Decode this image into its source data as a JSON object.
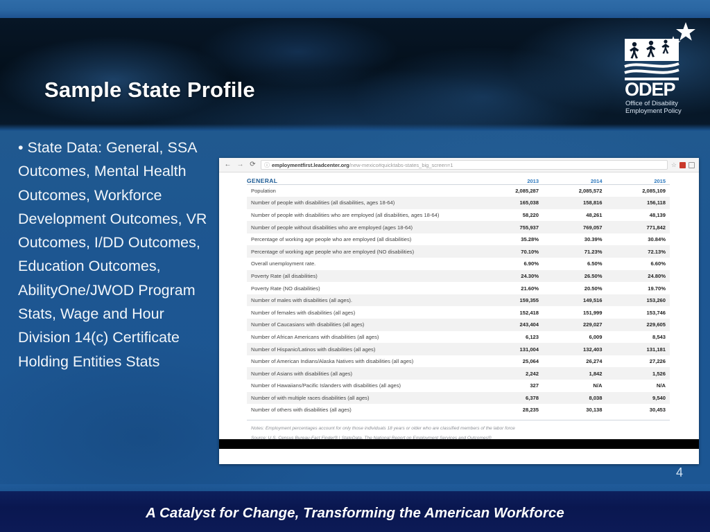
{
  "slide": {
    "title": "Sample State Profile",
    "number": "4",
    "footer": "A Catalyst for Change, Transforming the American Workforce",
    "colors": {
      "body_blue": "#1c5693",
      "hero_dark": "#05101e",
      "footer_navy": "#0a1750",
      "table_header_blue": "#1b5a94"
    }
  },
  "bullet": {
    "marker": "•",
    "text": "State Data: General, SSA Outcomes, Mental Health Outcomes, Workforce Development Outcomes, VR Outcomes, I/DD Outcomes, Education Outcomes, AbilityOne/JWOD Program Stats, Wage and Hour Division 14(c) Certificate Holding Entities Stats"
  },
  "logo": {
    "name": "odep-logo",
    "acronym": "ODEP",
    "line1": "Office of Disability",
    "line2": "Employment Policy"
  },
  "browser": {
    "back_icon": "←",
    "forward_icon": "→",
    "reload_icon": "⟳",
    "info_icon": "ⓘ",
    "star_icon": "☆",
    "url_bold": "employmentfirst.leadcenter.org",
    "url_rest": "/new-mexico#quicktabs-states_big_screen=1"
  },
  "chart_data": {
    "type": "table",
    "title": "GENERAL",
    "columns": [
      "",
      "2013",
      "2014",
      "2015"
    ],
    "rows": [
      {
        "label": "Population",
        "values": [
          "2,085,287",
          "2,085,572",
          "2,085,109"
        ]
      },
      {
        "label": "Number of people with disabilities (all disabilities, ages 18-64)",
        "values": [
          "165,038",
          "158,816",
          "156,118"
        ]
      },
      {
        "label": "Number of people with disabilities who are employed (all disabilities, ages 18-64)",
        "values": [
          "58,220",
          "48,261",
          "48,139"
        ]
      },
      {
        "label": "Number of people without disabilities who are employed (ages 18-64)",
        "values": [
          "755,937",
          "769,057",
          "771,842"
        ]
      },
      {
        "label": "Percentage of working age people who are employed (all disabilities)",
        "values": [
          "35.28%",
          "30.39%",
          "30.84%"
        ]
      },
      {
        "label": "Percentage of working age people who are employed (NO disabilities)",
        "values": [
          "70.10%",
          "71.23%",
          "72.13%"
        ]
      },
      {
        "label": "Overall unemployment rate.",
        "values": [
          "6.90%",
          "6.50%",
          "6.60%"
        ]
      },
      {
        "label": "Poverty Rate (all disabilities)",
        "values": [
          "24.30%",
          "26.50%",
          "24.80%"
        ]
      },
      {
        "label": "Poverty Rate (NO disabilities)",
        "values": [
          "21.60%",
          "20.50%",
          "19.70%"
        ]
      },
      {
        "label": "Number of males with disabilities (all ages).",
        "values": [
          "159,355",
          "149,516",
          "153,260"
        ]
      },
      {
        "label": "Number of females with disabilities (all ages)",
        "values": [
          "152,418",
          "151,999",
          "153,746"
        ]
      },
      {
        "label": "Number of Caucasians with disabilities (all ages)",
        "values": [
          "243,404",
          "229,027",
          "229,605"
        ]
      },
      {
        "label": "Number of African Americans with disabilities (all ages)",
        "values": [
          "6,123",
          "6,009",
          "8,543"
        ]
      },
      {
        "label": "Number of Hispanic/Latinos with disabilities (all ages)",
        "values": [
          "131,004",
          "132,403",
          "131,181"
        ]
      },
      {
        "label": "Number of American Indians/Alaska Natives with disabilities (all ages)",
        "values": [
          "25,064",
          "26,274",
          "27,226"
        ]
      },
      {
        "label": "Number of Asians with disabilities (all ages)",
        "values": [
          "2,242",
          "1,842",
          "1,526"
        ]
      },
      {
        "label": "Number of Hawaiians/Pacific Islanders with disabilities (all ages)",
        "values": [
          "327",
          "N/A",
          "N/A"
        ]
      },
      {
        "label": "Number of with multiple races disabilities (all ages)",
        "values": [
          "6,378",
          "8,038",
          "9,540"
        ]
      },
      {
        "label": "Number of others with disabilities (all ages)",
        "values": [
          "28,235",
          "30,138",
          "30,453"
        ]
      }
    ],
    "notes": "Notes: Employment percentages account for only those individuals 18 years or older who are classified members of the labor force",
    "source": "Source: U.S. Census Bureau-Fact Finder® | StateData, The National Report on Employment Services and Outcomes®"
  }
}
